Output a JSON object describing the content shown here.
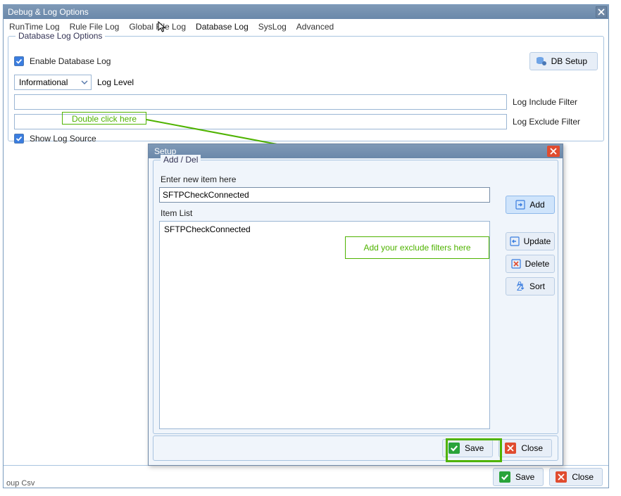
{
  "main": {
    "title": "Debug & Log Options",
    "tabs": [
      "RunTime Log",
      "Rule File Log",
      "Global File Log",
      "Database Log",
      "SysLog",
      "Advanced"
    ],
    "active_tab_index": 3,
    "group_title": "Database Log Options",
    "enable_label": "Enable Database Log",
    "db_setup_label": "DB Setup",
    "loglevel_value": "Informational",
    "loglevel_label": "Log Level",
    "include_label": "Log Include Filter",
    "exclude_label": "Log Exclude Filter",
    "showsource_label": "Show Log Source",
    "doubleclick_hint": "Double click here",
    "save_label": "Save",
    "close_label": "Close",
    "truncated_text": "oup Csv"
  },
  "setup": {
    "title": "Setup",
    "group_title": "Add / Del",
    "enter_label": "Enter new item here",
    "enter_value": "SFTPCheckConnected",
    "itemlist_label": "Item List",
    "list_items": [
      "SFTPCheckConnected"
    ],
    "add_label": "Add",
    "update_label": "Update",
    "delete_label": "Delete",
    "sort_label": "Sort",
    "hint": "Add your exclude filters here",
    "save_label": "Save",
    "close_label": "Close"
  }
}
